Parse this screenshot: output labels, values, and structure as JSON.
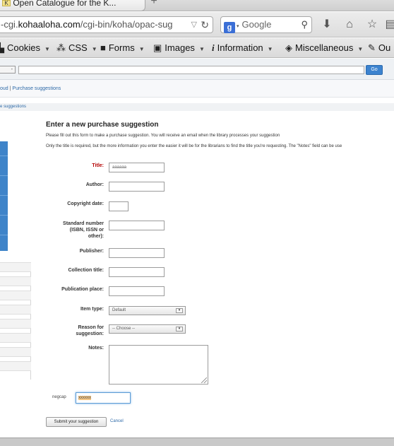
{
  "browser": {
    "tab_title": "Open Catalogue for the K...",
    "tab_favicon": "K",
    "new_tab_label": "+",
    "url_prefix": "-cgi.",
    "url_host": "kohaaloha.com",
    "url_path": "/cgi-bin/koha/opac-sug",
    "search_engine": "Google",
    "icons": [
      "dropdown-arrow-icon",
      "reload-icon",
      "google-icon",
      "search-icon",
      "download-icon",
      "home-icon",
      "bookmark-star-icon",
      "bookmarks-list-icon"
    ]
  },
  "webdev_toolbar": {
    "items": [
      {
        "label": "Cookies",
        "icon": "cookie-icon"
      },
      {
        "label": "CSS",
        "icon": "css-wand-icon"
      },
      {
        "label": "Forms",
        "icon": "forms-icon"
      },
      {
        "label": "Images",
        "icon": "image-icon"
      },
      {
        "label": "Information",
        "icon": "information-icon"
      },
      {
        "label": "Miscellaneous",
        "icon": "box-icon"
      },
      {
        "label": "Ou",
        "icon": "pencil-icon"
      }
    ]
  },
  "opac": {
    "library_select": "-",
    "go_label": "Go",
    "top_links": [
      "oud",
      "Purchase suggestions"
    ],
    "breadcrumb": "e suggestions"
  },
  "form": {
    "heading": "Enter a new purchase suggestion",
    "intro_1": "Please fill out this form to make a purchase suggestion. You will receive an email when the library processes your suggestion",
    "intro_2": "Only the title is required, but the more information you enter the easier it will be for the librarians to find the title you're requesting. The \"Notes\" field can be use",
    "fields": {
      "title": {
        "label": "Title:",
        "value": "aaaaaa"
      },
      "author": {
        "label": "Author:",
        "value": ""
      },
      "copyright": {
        "label": "Copyright date:",
        "value": ""
      },
      "standard_number": {
        "label_1": "Standard number",
        "label_2": "(ISBN, ISSN or",
        "label_3": "other):",
        "value": ""
      },
      "publisher": {
        "label": "Publisher:",
        "value": ""
      },
      "collection": {
        "label": "Collection title:",
        "value": ""
      },
      "place": {
        "label": "Publication place:",
        "value": ""
      },
      "item_type": {
        "label": "Item type:",
        "value": "Default"
      },
      "reason": {
        "label_1": "Reason for",
        "label_2": "suggestion:",
        "value": "-- Choose --"
      },
      "notes": {
        "label": "Notes:",
        "value": ""
      }
    },
    "negcap": {
      "label": "negcap",
      "value": "xxxxxx"
    },
    "submit_label": "Submit your suggestion",
    "cancel_label": "Cancel"
  }
}
